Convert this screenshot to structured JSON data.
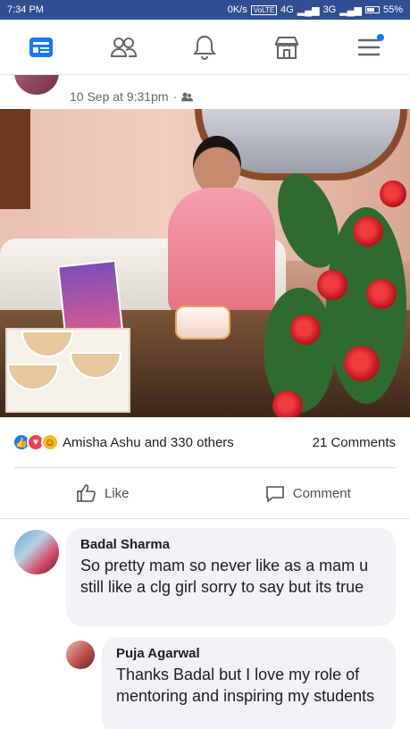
{
  "status_bar": {
    "time": "7:34 PM",
    "network": "0K/s",
    "signal_1": "4G",
    "signal_2": "3G",
    "battery": "55%"
  },
  "top_nav": {
    "items": [
      {
        "icon": "news-feed-icon",
        "active": true
      },
      {
        "icon": "friends-icon",
        "active": false
      },
      {
        "icon": "notifications-bell-icon",
        "active": false
      },
      {
        "icon": "marketplace-icon",
        "active": false
      },
      {
        "icon": "menu-icon",
        "active": false,
        "has_dot": true
      }
    ],
    "accent_color": "#1877f2"
  },
  "post": {
    "timestamp": "10 Sep at 9:31pm",
    "audience_icon": "friends-audience-icon",
    "photo_icon": "post-photo",
    "reactions": {
      "icons": [
        "like-reaction-icon",
        "love-reaction-icon",
        "wow-reaction-icon"
      ],
      "summary": "Amisha Ashu and 330 others"
    },
    "comments_count": "21 Comments",
    "actions": {
      "like_label": "Like",
      "comment_label": "Comment"
    }
  },
  "comments": [
    {
      "name": "Badal Sharma",
      "text": "So pretty mam so never like as a mam u still like a clg girl sorry to say but its true"
    },
    {
      "name": "Puja Agarwal",
      "text": "Thanks Badal but I love my role of mentoring and inspiring my students"
    }
  ]
}
